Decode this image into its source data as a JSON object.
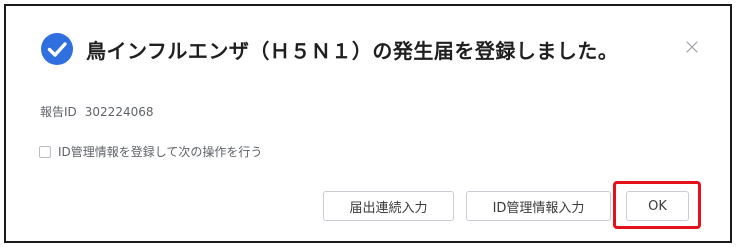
{
  "dialog": {
    "title": "鳥インフルエンザ（Ｈ５Ｎ１）の発生届を登録しました。",
    "status_icon": "check-circle-icon",
    "close_icon": "close-icon",
    "report_id_label": "報告ID",
    "report_id_value": "302224068",
    "checkbox_label": "ID管理情報を登録して次の操作を行う",
    "checkbox_checked": false
  },
  "buttons": {
    "continue_label": "届出連続入力",
    "id_info_label": "ID管理情報入力",
    "ok_label": "OK"
  },
  "colors": {
    "accent": "#2f6fde",
    "highlight": "#e5101a",
    "text_primary": "#1f1f1f",
    "text_secondary": "#5f6368"
  }
}
